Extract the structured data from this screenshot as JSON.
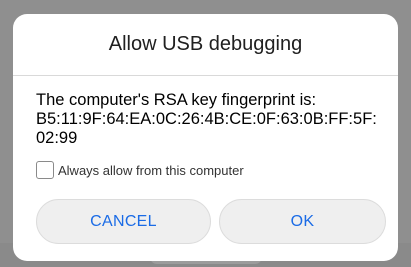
{
  "dialog": {
    "title": "Allow USB debugging",
    "message_lines": [
      "The computer's RSA key fingerprint is:",
      "B5:11:9F:64:EA:0C:26:4B:CE:0F:63:0B:FF:5F:",
      "02:99"
    ],
    "checkbox": {
      "label": "Always allow from this computer",
      "checked": false
    },
    "buttons": {
      "cancel_label": "CANCEL",
      "ok_label": "OK"
    }
  },
  "colors": {
    "accent": "#1a6be6",
    "overlay": "#8f8f8f",
    "dialog_bg": "#ffffff",
    "button_bg": "#efefef"
  }
}
